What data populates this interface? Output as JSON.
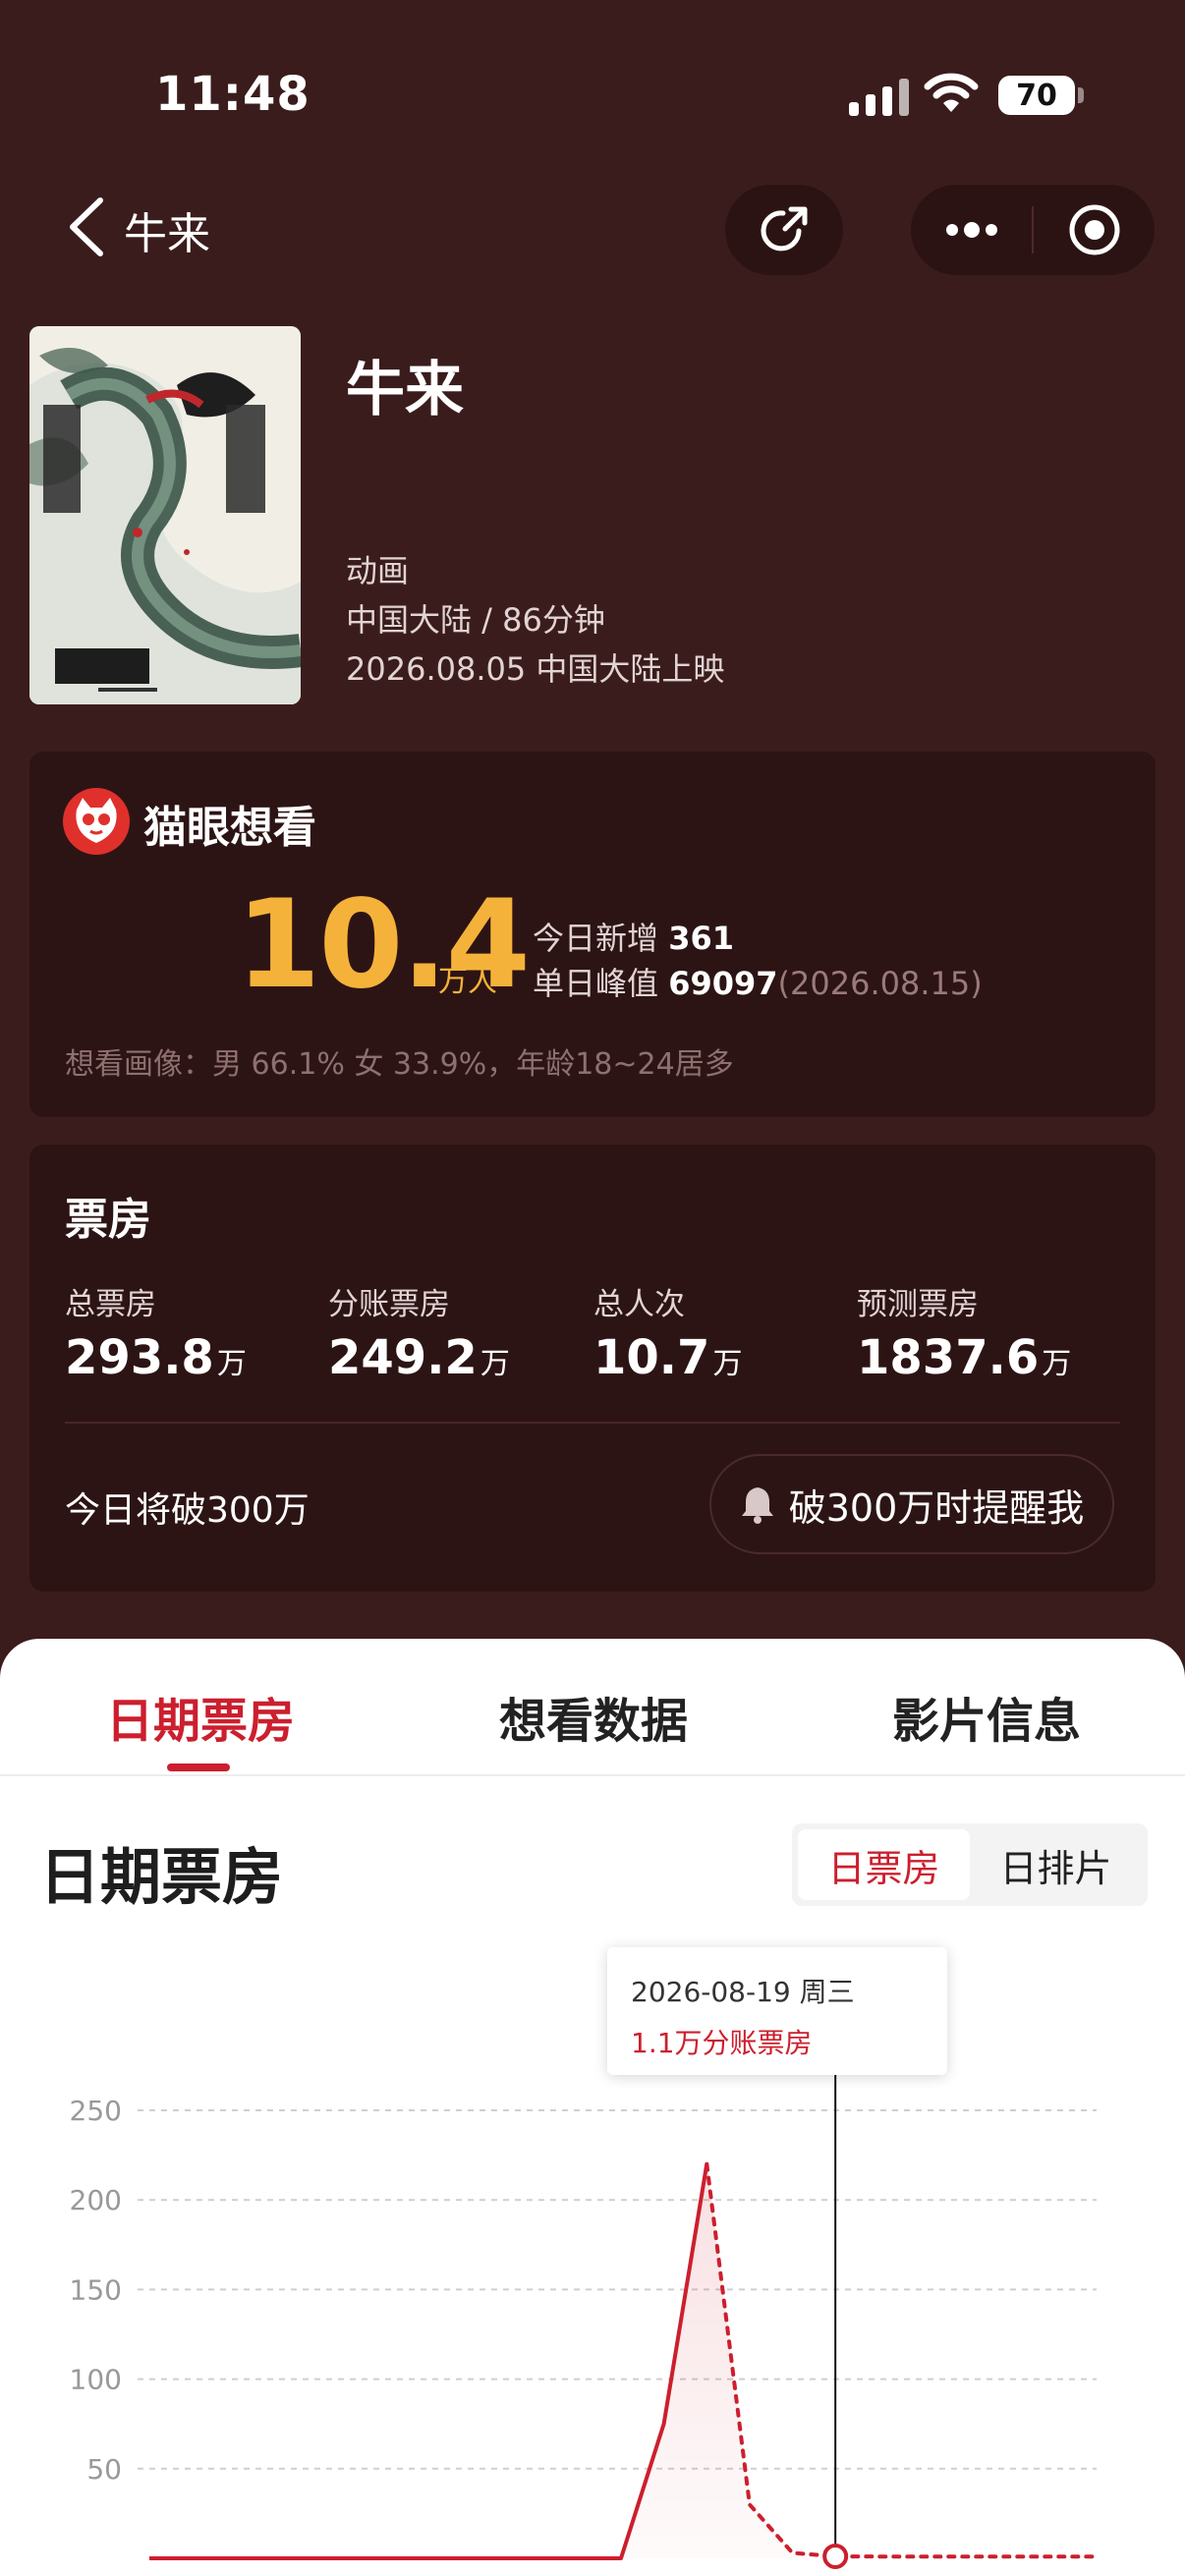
{
  "status_bar": {
    "time": "11:48",
    "battery": "70"
  },
  "nav": {
    "title": "牛来"
  },
  "movie": {
    "title": "牛来",
    "genre": "动画",
    "region_duration": "中国大陆 / 86分钟",
    "release": "2026.08.05 中国大陆上映"
  },
  "want": {
    "label": "猫眼想看",
    "count": "10.4",
    "count_unit": "万人",
    "today_label": "今日新增",
    "today_value": "361",
    "peak_label": "单日峰值",
    "peak_value": "69097",
    "peak_date": "(2026.08.15)",
    "portrait": "想看画像：男 66.1% 女 33.9%，年龄18~24居多"
  },
  "box_office": {
    "title": "票房",
    "stats": [
      {
        "label": "总票房",
        "value": "293.8",
        "unit": "万"
      },
      {
        "label": "分账票房",
        "value": "249.2",
        "unit": "万"
      },
      {
        "label": "总人次",
        "value": "10.7",
        "unit": "万"
      },
      {
        "label": "预测票房",
        "value": "1837.6",
        "unit": "万"
      }
    ],
    "today_text": "今日将破300万",
    "remind_label": "破300万时提醒我"
  },
  "tabs": [
    "日期票房",
    "想看数据",
    "影片信息"
  ],
  "section": {
    "title": "日期票房",
    "toggle": [
      "日票房",
      "日排片"
    ]
  },
  "tooltip": {
    "date": "2026-08-19 周三",
    "value": "1.1万分账票房"
  },
  "colors": {
    "accent": "#cc1f2e",
    "gold": "#f5b23a",
    "bg": "#3b1c1c"
  },
  "chart_data": {
    "type": "line",
    "yticks": [
      250,
      200,
      150,
      100,
      50
    ],
    "ylim": [
      0,
      250
    ],
    "series": [
      {
        "values": [
          0,
          0,
          0,
          0,
          0,
          0,
          0,
          0,
          0,
          0,
          0,
          0,
          75,
          220,
          30,
          3,
          1.1,
          1,
          1,
          1,
          1,
          1,
          1
        ]
      }
    ],
    "actual_count": 14,
    "highlight_index": 16
  }
}
